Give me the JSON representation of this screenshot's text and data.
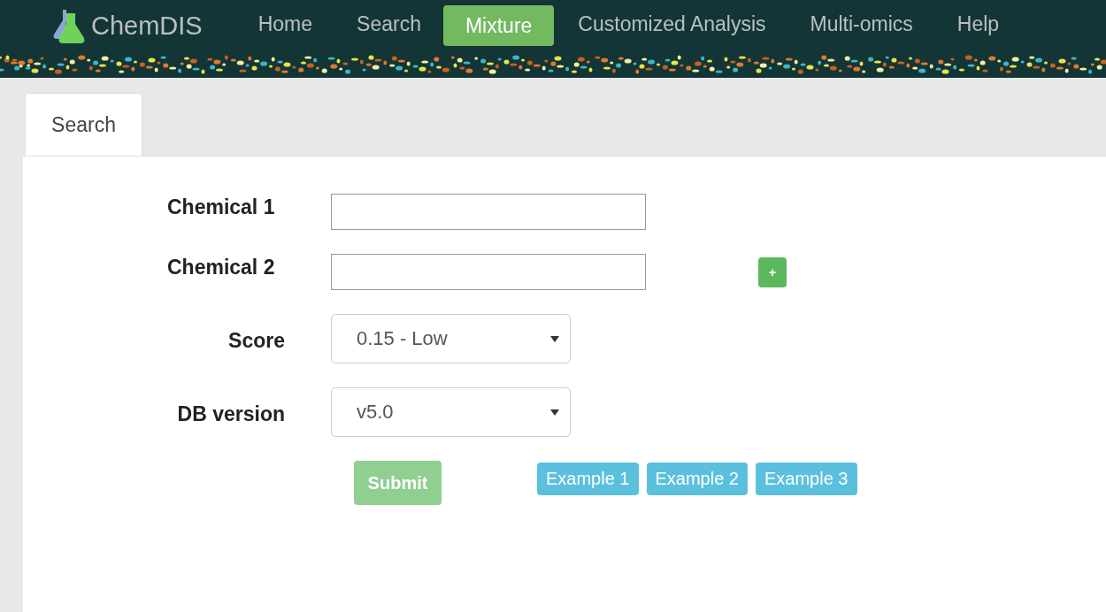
{
  "brand": {
    "name": "ChemDIS"
  },
  "nav": [
    {
      "label": "Home",
      "selected": false
    },
    {
      "label": "Search",
      "selected": false
    },
    {
      "label": "Mixture",
      "selected": true
    },
    {
      "label": "Customized Analysis",
      "selected": false
    },
    {
      "label": "Multi-omics",
      "selected": false
    },
    {
      "label": "Help",
      "selected": false
    }
  ],
  "tabs": [
    {
      "label": "Search",
      "selected": true
    }
  ],
  "form": {
    "fields": [
      {
        "kind": "text",
        "label": "Chemical 1"
      },
      {
        "kind": "text",
        "label": "Chemical 2",
        "add_button": "+"
      },
      {
        "kind": "select",
        "label": "Score",
        "value": "0.15 - Low"
      },
      {
        "kind": "select",
        "label": "DB version",
        "value": "v5.0"
      }
    ],
    "submit": {
      "label": "Submit",
      "disabled": true
    },
    "examples": [
      "Example 1",
      "Example 2",
      "Example 3"
    ]
  }
}
